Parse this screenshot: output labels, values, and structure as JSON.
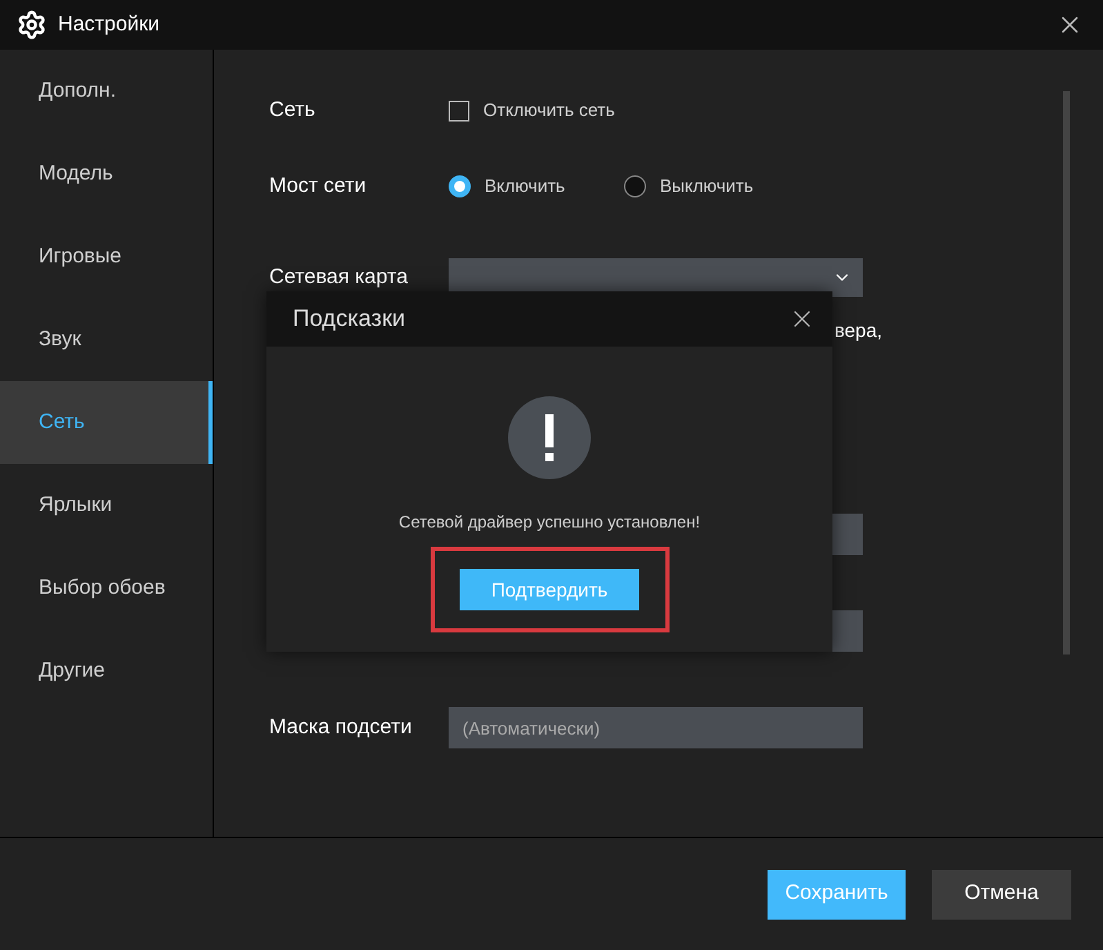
{
  "window": {
    "title": "Настройки"
  },
  "sidebar": {
    "items": [
      {
        "label": "Дополн.",
        "selected": false
      },
      {
        "label": "Модель",
        "selected": false
      },
      {
        "label": "Игровые",
        "selected": false
      },
      {
        "label": "Звук",
        "selected": false
      },
      {
        "label": "Сеть",
        "selected": true
      },
      {
        "label": "Ярлыки",
        "selected": false
      },
      {
        "label": "Выбор обоев",
        "selected": false
      },
      {
        "label": "Другие",
        "selected": false
      }
    ]
  },
  "network": {
    "label": "Сеть",
    "checkbox": {
      "label": "Отключить сеть",
      "checked": false
    }
  },
  "bridge": {
    "label": "Мост сети",
    "options": [
      {
        "label": "Включить",
        "selected": true
      },
      {
        "label": "Выключить",
        "selected": false
      }
    ]
  },
  "adapter": {
    "label": "Сетевая карта"
  },
  "note_fragment": "вера,",
  "subnet": {
    "label": "Маска подсети",
    "placeholder": "(Автоматически)"
  },
  "dialog": {
    "title": "Подсказки",
    "message": "Сетевой драйвер успешно установлен!",
    "confirm": "Подтвердить",
    "highlighted": true
  },
  "buttons": {
    "save": "Сохранить",
    "cancel": "Отмена"
  }
}
